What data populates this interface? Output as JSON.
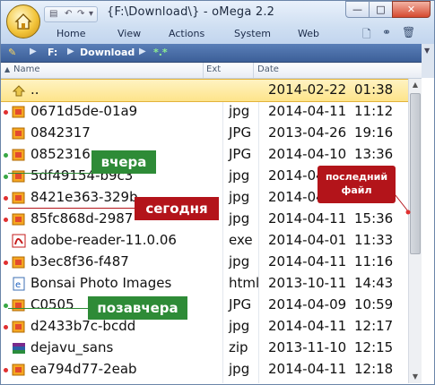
{
  "window": {
    "title": "{F:\\Download\\} - oMega 2.2",
    "minimize": "—",
    "maximize": "□",
    "close": "✕"
  },
  "menu": [
    "Home",
    "View",
    "Actions",
    "System",
    "Web"
  ],
  "path": {
    "drive": "F:",
    "folder": "Download",
    "filter": "*.*"
  },
  "columns": {
    "name": "Name",
    "ext": "Ext",
    "date": "Date"
  },
  "files": [
    {
      "name": "..",
      "ext": "",
      "date": "2014-02-22",
      "time": "01:38",
      "icon": "folder-up-icon",
      "selected": true,
      "mark": ""
    },
    {
      "name": "0671d5de-01a9",
      "ext": "jpg",
      "date": "2014-04-11",
      "time": "11:12",
      "icon": "image-file-icon",
      "mark": "red"
    },
    {
      "name": "0842317",
      "ext": "JPG",
      "date": "2013-04-26",
      "time": "19:16",
      "icon": "image-file-icon",
      "mark": ""
    },
    {
      "name": "0852316",
      "ext": "JPG",
      "date": "2014-04-10",
      "time": "13:36",
      "icon": "image-file-icon",
      "mark": "green"
    },
    {
      "name": "5df49154-b9c3",
      "ext": "jpg",
      "date": "2014-04",
      "time": "",
      "icon": "image-file-icon",
      "mark": "green"
    },
    {
      "name": "8421e363-329b",
      "ext": "jpg",
      "date": "2014-04",
      "time": "",
      "icon": "image-file-icon",
      "mark": "red"
    },
    {
      "name": "85fc868d-2987",
      "ext": "jpg",
      "date": "2014-04-11",
      "time": "15:36",
      "icon": "image-file-icon",
      "mark": "red"
    },
    {
      "name": "adobe-reader-11.0.06",
      "ext": "exe",
      "date": "2014-04-01",
      "time": "11:33",
      "icon": "pdf-exe-icon",
      "mark": ""
    },
    {
      "name": "b3ec8f36-f487",
      "ext": "jpg",
      "date": "2014-04-11",
      "time": "11:16",
      "icon": "image-file-icon",
      "mark": "red"
    },
    {
      "name": "Bonsai Photo Images",
      "ext": "html",
      "date": "2013-10-11",
      "time": "14:43",
      "icon": "html-file-icon",
      "mark": ""
    },
    {
      "name": "C0505",
      "ext": "JPG",
      "date": "2014-04-09",
      "time": "10:59",
      "icon": "image-file-icon",
      "mark": "green"
    },
    {
      "name": "d2433b7c-bcdd",
      "ext": "jpg",
      "date": "2014-04-11",
      "time": "12:17",
      "icon": "image-file-icon",
      "mark": "red"
    },
    {
      "name": "dejavu_sans",
      "ext": "zip",
      "date": "2013-11-10",
      "time": "12:15",
      "icon": "archive-file-icon",
      "mark": ""
    },
    {
      "name": "ea794d77-2eab",
      "ext": "jpg",
      "date": "2014-04-11",
      "time": "12:18",
      "icon": "image-file-icon",
      "mark": "red"
    }
  ],
  "annotations": {
    "yesterday": "вчера",
    "today": "сегодня",
    "day_before": "позавчера",
    "last_file_line1": "последний",
    "last_file_line2": "файл"
  },
  "colors": {
    "green_label": "#2e8b37",
    "red_label": "#b3141a",
    "selection": "#fde48a"
  }
}
